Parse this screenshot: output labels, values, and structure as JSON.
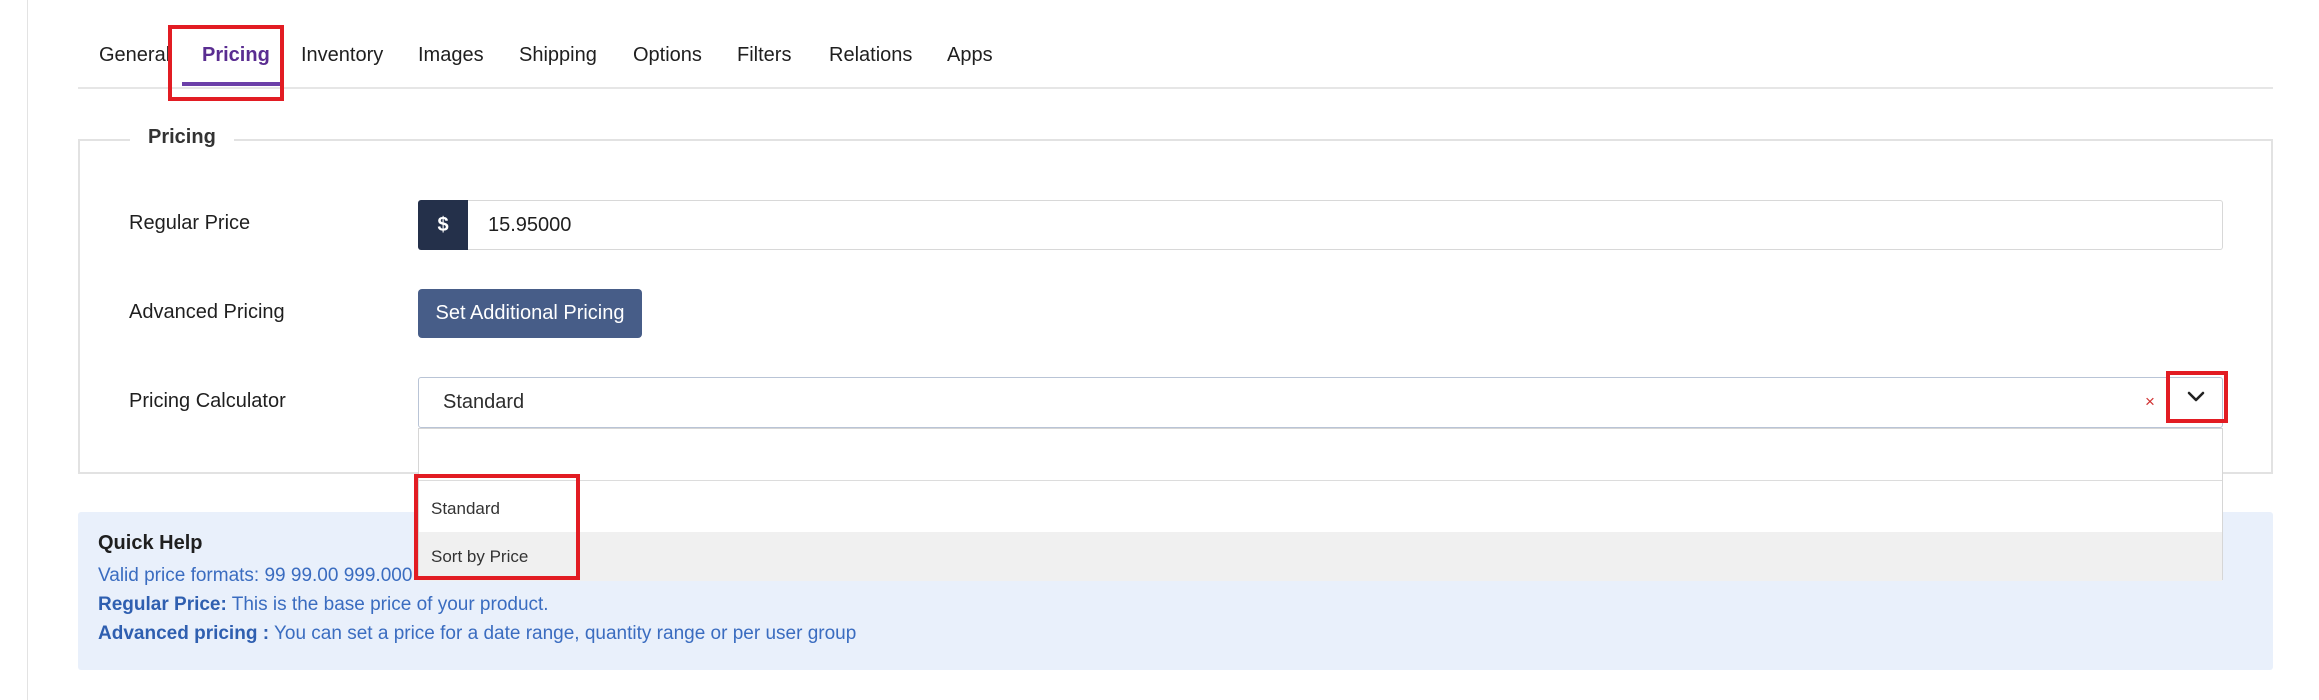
{
  "tabs": [
    {
      "label": "General"
    },
    {
      "label": "Pricing",
      "active": true
    },
    {
      "label": "Inventory"
    },
    {
      "label": "Images"
    },
    {
      "label": "Shipping"
    },
    {
      "label": "Options"
    },
    {
      "label": "Filters"
    },
    {
      "label": "Relations"
    },
    {
      "label": "Apps"
    }
  ],
  "pricing": {
    "legend": "Pricing",
    "regular_price": {
      "label": "Regular Price",
      "currency_symbol": "$",
      "value": "15.95000"
    },
    "advanced_pricing": {
      "label": "Advanced Pricing",
      "button_label": "Set Additional Pricing"
    },
    "calculator": {
      "label": "Pricing Calculator",
      "selected": "Standard",
      "clear_symbol": "×",
      "options": [
        "Standard",
        "Sort by Price"
      ],
      "highlighted_option": "Sort by Price"
    }
  },
  "quick_help": {
    "title": "Quick Help",
    "line1": "Valid price formats: 99 99.00 999.000",
    "line2_bold": "Regular Price:",
    "line2_text": " This is the base price of your product.",
    "line3_bold": "Advanced pricing :",
    "line3_text": " You can set a price for a date range, quantity range or per user group"
  },
  "icons": {
    "toggle": "chevron-down-icon"
  },
  "colors": {
    "accent": "#6b3fa8",
    "currency_addon": "#24304a",
    "button": "#475d88",
    "help_bg": "#e9f0fb",
    "help_text": "#3a6cc0",
    "highlight": "#e21c23"
  }
}
